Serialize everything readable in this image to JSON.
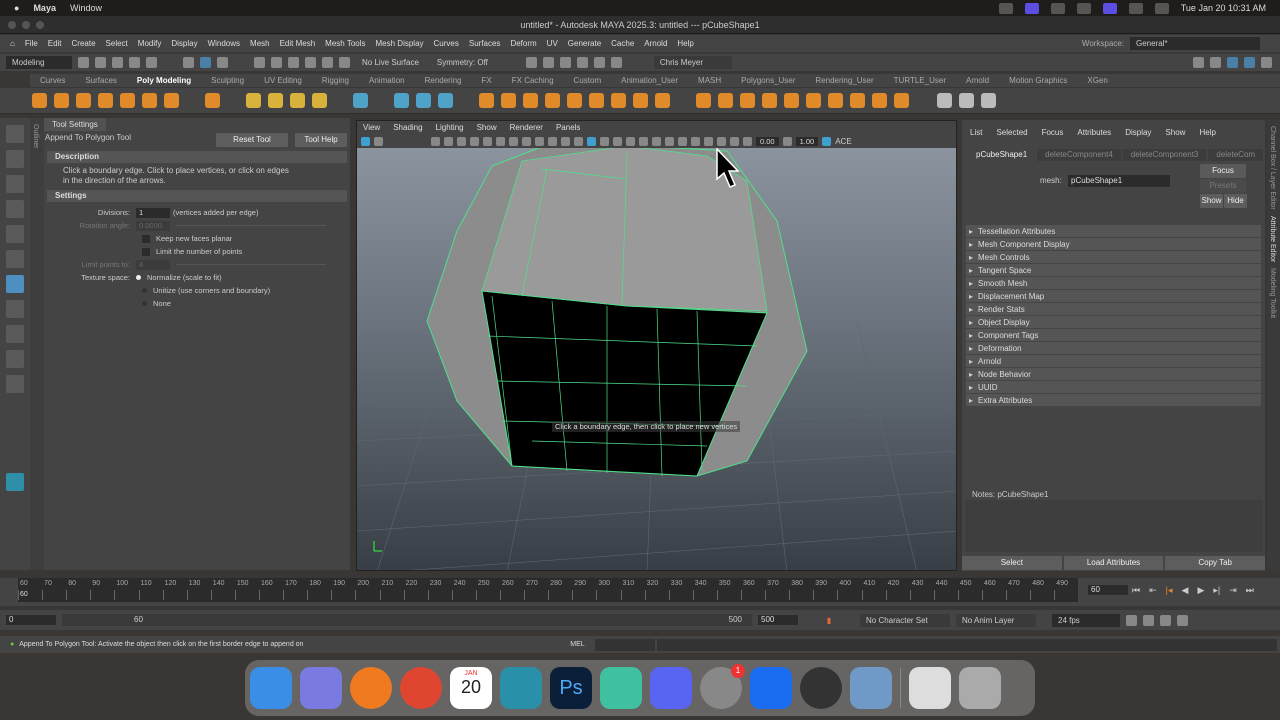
{
  "mac": {
    "app": "Maya",
    "menu": [
      "Window"
    ],
    "clock": "Tue Jan 20  10:31 AM"
  },
  "title": "untitled* - Autodesk MAYA 2025.3: untitled   ---   pCubeShape1",
  "menus": [
    "File",
    "Edit",
    "Create",
    "Select",
    "Modify",
    "Display",
    "Windows",
    "Mesh",
    "Edit Mesh",
    "Mesh Tools",
    "Mesh Display",
    "Curves",
    "Surfaces",
    "Deform",
    "UV",
    "Generate",
    "Cache",
    "Arnold",
    "Help"
  ],
  "workspace": {
    "label": "Workspace:",
    "value": "General*"
  },
  "status": {
    "mode": "Modeling",
    "live_surface": "No Live Surface",
    "symmetry": "Symmetry: Off",
    "user": "Chris Meyer"
  },
  "shelf_tabs": [
    "Curves",
    "Surfaces",
    "Poly Modeling",
    "Sculpting",
    "UV Editing",
    "Rigging",
    "Animation",
    "Rendering",
    "FX",
    "FX Caching",
    "Custom",
    "Animation_User",
    "MASH",
    "Polygons_User",
    "Rendering_User",
    "TURTLE_User",
    "Arnold",
    "Motion Graphics",
    "XGen"
  ],
  "outliner_label": "Outliner",
  "tool": {
    "tab": "Tool Settings",
    "name": "Append To Polygon Tool",
    "reset": "Reset Tool",
    "help": "Tool Help",
    "description_header": "Description",
    "description": "Click a boundary edge. Click to place vertices, or click on edges in the direction of the arrows.",
    "settings_header": "Settings",
    "divisions_label": "Divisions:",
    "divisions": "1",
    "divisions_note": "(vertices added per edge)",
    "rotation_label": "Rotation angle:",
    "rotation": "0.0000",
    "keep_planar": "Keep new faces planar",
    "limit_points": "Limit the number of points",
    "limit_label": "Limit points to:",
    "limit": "4",
    "texture_label": "Texture space:",
    "tex_opts": [
      "Normalize (scale to fit)",
      "Unitize (use corners and boundary)",
      "None"
    ]
  },
  "viewport": {
    "menus": [
      "View",
      "Shading",
      "Lighting",
      "Show",
      "Renderer",
      "Panels"
    ],
    "exposure": "0.00",
    "gamma": "1.00",
    "color": "ACE",
    "hint": "Click a boundary edge, then click to place new vertices"
  },
  "attr": {
    "menus": [
      "List",
      "Selected",
      "Focus",
      "Attributes",
      "Display",
      "Show",
      "Help"
    ],
    "tabs": [
      "pCubeShape1",
      "deleteComponent4",
      "deleteComponent3",
      "deleteCom"
    ],
    "mesh_label": "mesh:",
    "mesh": "pCubeShape1",
    "focus": "Focus",
    "presets": "Presets",
    "show": "Show",
    "hide": "Hide",
    "sections": [
      "Tessellation Attributes",
      "Mesh Component Display",
      "Mesh Controls",
      "Tangent Space",
      "Smooth Mesh",
      "Displacement Map",
      "Render Stats",
      "Object Display",
      "Component Tags",
      "Deformation",
      "Arnold",
      "Node Behavior",
      "UUID",
      "Extra Attributes"
    ],
    "notes": "Notes:  pCubeShape1",
    "select": "Select",
    "load": "Load Attributes",
    "copy": "Copy Tab"
  },
  "side_tabs": [
    "Channel Box / Layer Editor",
    "Attribute Editor",
    "Modeling Toolkit"
  ],
  "time": {
    "ticks": [
      "60",
      "70",
      "80",
      "90",
      "100",
      "110",
      "120",
      "130",
      "140",
      "150",
      "160",
      "170",
      "180",
      "190",
      "200",
      "210",
      "220",
      "230",
      "240",
      "250",
      "260",
      "270",
      "280",
      "290",
      "300",
      "310",
      "320",
      "330",
      "340",
      "350",
      "360",
      "370",
      "380",
      "390",
      "400",
      "410",
      "420",
      "430",
      "440",
      "450",
      "460",
      "470",
      "480",
      "490"
    ],
    "current": "60",
    "current_field": "60",
    "start": "0",
    "range_start": "60",
    "range_end": "500",
    "end": "500",
    "char_set": "No Character Set",
    "anim_layer": "No Anim Layer",
    "fps": "24 fps"
  },
  "helpline": {
    "text": "Append To Polygon Tool: Activate the object then click on the first border edge to append on",
    "mel": "MEL"
  },
  "dock": {
    "calendar_month": "JAN",
    "calendar_day": "20",
    "badge": "1"
  }
}
